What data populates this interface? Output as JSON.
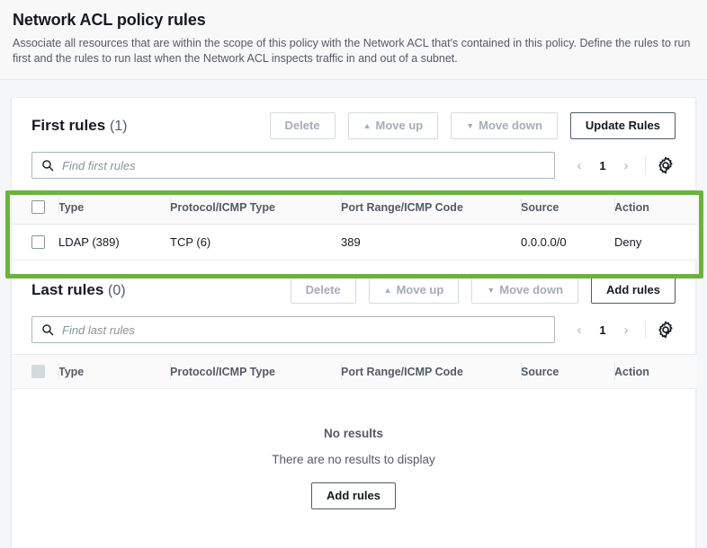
{
  "header": {
    "title": "Network ACL policy rules",
    "description": "Associate all resources that are within the scope of this policy with the Network ACL that's contained in this policy. Define the rules to run first and the rules to run last when the Network ACL inspects traffic in and out of a subnet."
  },
  "accent": {
    "highlight_green": "#6cb33e",
    "text_dark": "#16191f",
    "text_muted": "#545b64",
    "border": "#eaeded"
  },
  "first_rules": {
    "title": "First rules",
    "count": "(1)",
    "buttons": {
      "delete": "Delete",
      "move_up": "Move up",
      "move_down": "Move down",
      "primary": "Update Rules"
    },
    "search_placeholder": "Find first rules",
    "pagination": {
      "prev": "‹",
      "page": "1",
      "next": "›"
    },
    "columns": [
      "Type",
      "Protocol/ICMP Type",
      "Port Range/ICMP Code",
      "Source",
      "Action"
    ],
    "rows": [
      {
        "type": "LDAP (389)",
        "protocol": "TCP (6)",
        "port_range": "389",
        "source": "0.0.0.0/0",
        "action": "Deny"
      }
    ]
  },
  "last_rules": {
    "title": "Last rules",
    "count": "(0)",
    "buttons": {
      "delete": "Delete",
      "move_up": "Move up",
      "move_down": "Move down",
      "primary": "Add rules"
    },
    "search_placeholder": "Find last rules",
    "pagination": {
      "prev": "‹",
      "page": "1",
      "next": "›"
    },
    "columns": [
      "Type",
      "Protocol/ICMP Type",
      "Port Range/ICMP Code",
      "Source",
      "Action"
    ],
    "empty": {
      "title": "No results",
      "subtitle": "There are no results to display",
      "button": "Add rules"
    }
  },
  "icons": {
    "search": "search-icon",
    "gear": "gear-icon",
    "move_up_arrow": "▲",
    "move_down_arrow": "▼"
  }
}
